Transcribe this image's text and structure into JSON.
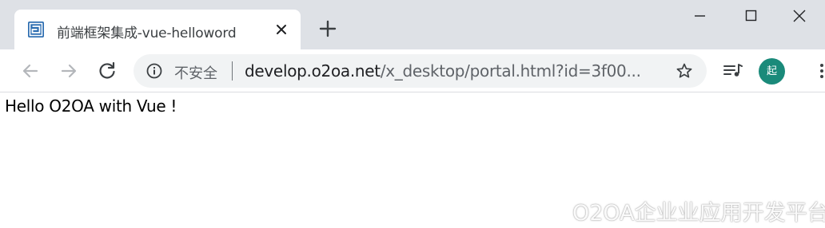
{
  "tab": {
    "title": "前端框架集成-vue-helloword",
    "favicon": "o2oa-logo-icon"
  },
  "toolbar": {
    "security_label": "不安全",
    "url_host": "develop.o2oa.net",
    "url_path": "/x_desktop/portal.html?id=3f00...",
    "avatar_letter": "起",
    "avatar_color": "#1a8a7a"
  },
  "page": {
    "hello_text": "Hello O2OA with Vue !"
  },
  "watermark": {
    "text": "O2OA企业业应用开发平台"
  },
  "colors": {
    "tabstrip_bg": "#dee1e6",
    "omnibox_bg": "#f1f3f4",
    "favicon_blue": "#2b6cb0"
  }
}
